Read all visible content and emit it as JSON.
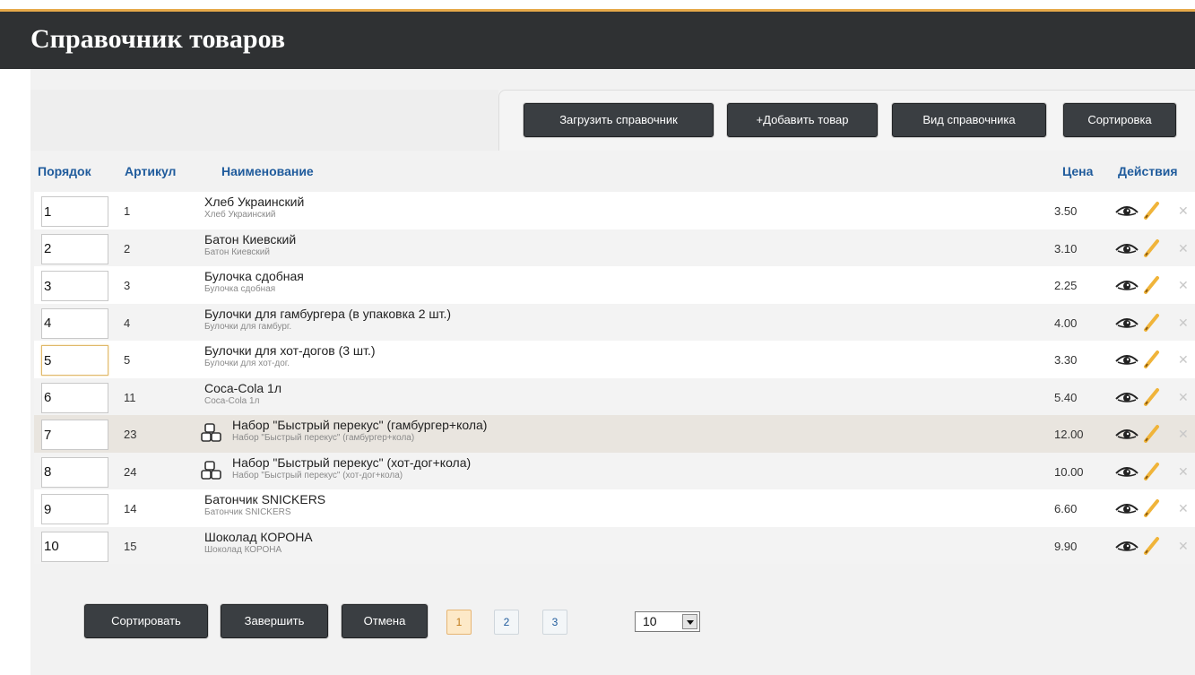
{
  "page": {
    "title": "Справочник товаров"
  },
  "toolbar": {
    "load_label": "Загрузить справочник",
    "add_label": "+Добавить товар",
    "view_label": "Вид справочника",
    "sort_label": "Сортировка"
  },
  "table": {
    "headers": {
      "order": "Порядок",
      "sku": "Артикул",
      "name": "Наименование",
      "price": "Цена",
      "actions": "Действия"
    },
    "rows": [
      {
        "order": "1",
        "sku": "1",
        "name": "Хлеб Украинский",
        "sub": "Хлеб Украинский",
        "price": "3.50"
      },
      {
        "order": "2",
        "sku": "2",
        "name": "Батон Киевский",
        "sub": "Батон Киевский",
        "price": "3.10"
      },
      {
        "order": "3",
        "sku": "3",
        "name": "Булочка сдобная",
        "sub": "Булочка сдобная",
        "price": "2.25"
      },
      {
        "order": "4",
        "sku": "4",
        "name": "Булочки для гамбургера (в упаковка 2 шт.)",
        "sub": "Булочки для гамбург.",
        "price": "4.00"
      },
      {
        "order": "5",
        "sku": "5",
        "name": "Булочки для хот-догов (3 шт.)",
        "sub": "Булочки для хот-дог.",
        "price": "3.30"
      },
      {
        "order": "6",
        "sku": "11",
        "name": "Coca-Cola 1л",
        "sub": "Coca-Cola 1л",
        "price": "5.40"
      },
      {
        "order": "7",
        "sku": "23",
        "name": "Набор \"Быстрый перекус\" (гамбургер+кола)",
        "sub": "Набор \"Быстрый перекус\" (гамбургер+кола)",
        "price": "12.00"
      },
      {
        "order": "8",
        "sku": "24",
        "name": "Набор \"Быстрый перекус\" (хот-дог+кола)",
        "sub": "Набор \"Быстрый перекус\" (хот-дог+кола)",
        "price": "10.00"
      },
      {
        "order": "9",
        "sku": "14",
        "name": "Батончик SNICKERS",
        "sub": "Батончик SNICKERS",
        "price": "6.60"
      },
      {
        "order": "10",
        "sku": "15",
        "name": "Шоколад КОРОНА",
        "sub": "Шоколад КОРОНА",
        "price": "9.90"
      }
    ]
  },
  "footer": {
    "sort_label": "Сортировать",
    "finish_label": "Завершить",
    "cancel_label": "Отмена",
    "pages": [
      "1",
      "2",
      "3"
    ],
    "current_page": "1",
    "page_size": "10"
  },
  "icons": {
    "view": "eye-icon",
    "edit": "pencil-icon",
    "delete": "close-icon",
    "kit": "kit-icon",
    "dropdown": "chevron-down-icon"
  },
  "colors": {
    "header_bg": "#2f3133",
    "accent": "#e6a94a",
    "link": "#1f5b9c",
    "button_bg": "#3a3e42"
  }
}
